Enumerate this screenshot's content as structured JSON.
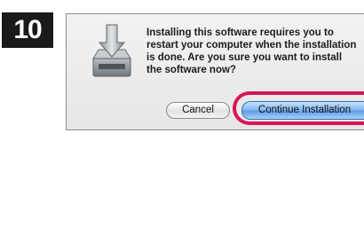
{
  "step": {
    "number": "10"
  },
  "dialog": {
    "message": "Installing this software requires you to restart your computer when the installation is done. Are you sure you want to install the software now?",
    "cancel_label": "Cancel",
    "continue_label": "Continue Installation",
    "icon": "disk-install-icon"
  },
  "colors": {
    "highlight": "#d8145a",
    "default_button": "#5b9be6",
    "badge": "#1a1a1a"
  }
}
